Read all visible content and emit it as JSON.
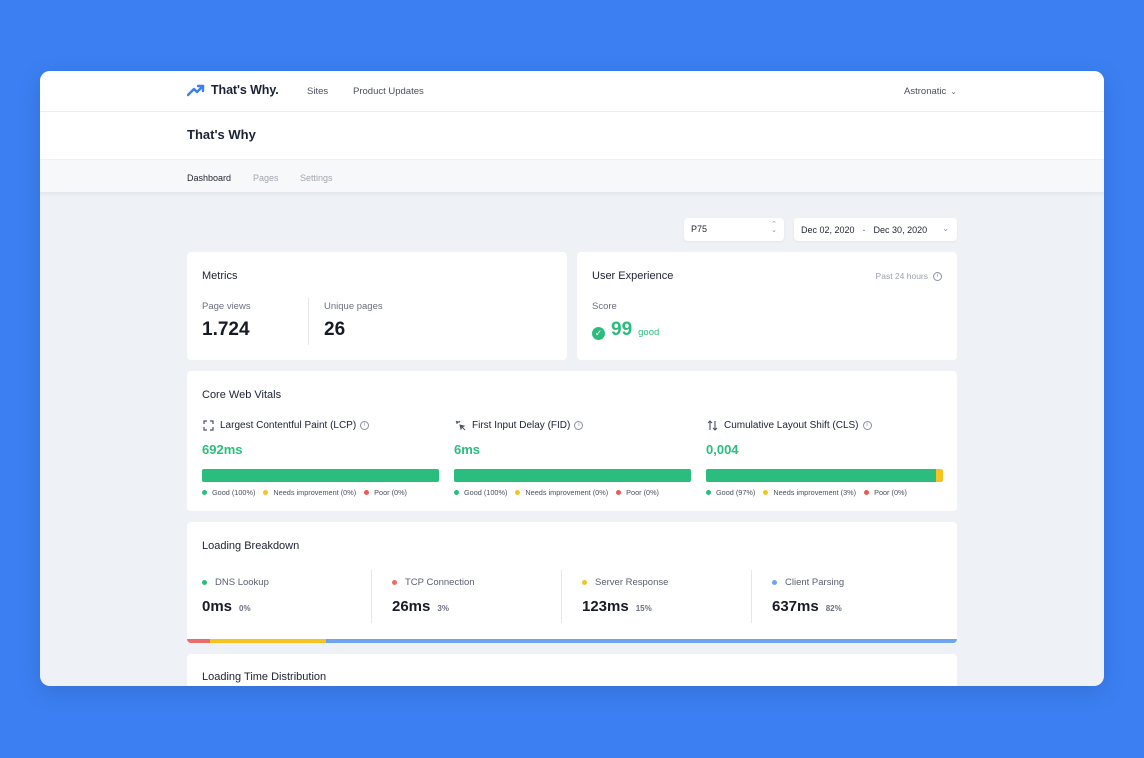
{
  "app": {
    "brand": "That's Why.",
    "nav": [
      "Sites",
      "Product Updates"
    ],
    "account": "Astronatic"
  },
  "page": {
    "title": "That's Why",
    "tabs": [
      "Dashboard",
      "Pages",
      "Settings"
    ],
    "active_tab": "Dashboard"
  },
  "filters": {
    "percentile": "P75",
    "date_from": "Dec 02, 2020",
    "date_sep": "-",
    "date_to": "Dec 30, 2020"
  },
  "metrics": {
    "title": "Metrics",
    "page_views_label": "Page views",
    "page_views": "1.724",
    "unique_pages_label": "Unique pages",
    "unique_pages": "26"
  },
  "user_experience": {
    "title": "User Experience",
    "period": "Past 24 hours",
    "score_label": "Score",
    "score": "99",
    "rating": "good"
  },
  "core_web_vitals": {
    "title": "Core Web Vitals",
    "items": [
      {
        "name": "Largest Contentful Paint (LCP)",
        "icon": "expand-icon",
        "value": "692ms",
        "good": 100,
        "ni": 0,
        "poor": 0,
        "legend": [
          "Good (100%)",
          "Needs improvement (0%)",
          "Poor (0%)"
        ]
      },
      {
        "name": "First Input Delay (FID)",
        "icon": "click-icon",
        "value": "6ms",
        "good": 100,
        "ni": 0,
        "poor": 0,
        "legend": [
          "Good (100%)",
          "Needs improvement (0%)",
          "Poor (0%)"
        ]
      },
      {
        "name": "Cumulative Layout Shift (CLS)",
        "icon": "shift-arrows-icon",
        "value": "0,004",
        "good": 97,
        "ni": 3,
        "poor": 0,
        "legend": [
          "Good (97%)",
          "Needs improvement (3%)",
          "Poor (0%)"
        ]
      }
    ]
  },
  "loading_breakdown": {
    "title": "Loading Breakdown",
    "items": [
      {
        "name": "DNS Lookup",
        "value": "0ms",
        "pct": "0%",
        "share": 0,
        "color": "#2bbd7e"
      },
      {
        "name": "TCP Connection",
        "value": "26ms",
        "pct": "3%",
        "share": 3,
        "color": "#ee6b6b"
      },
      {
        "name": "Server Response",
        "value": "123ms",
        "pct": "15%",
        "share": 15,
        "color": "#f5c322"
      },
      {
        "name": "Client Parsing",
        "value": "637ms",
        "pct": "82%",
        "share": 82,
        "color": "#6ea3f2"
      }
    ]
  },
  "loading_time_distribution": {
    "title": "Loading Time Distribution"
  },
  "colors": {
    "accent": "#3b7ff2",
    "good": "#2bbd7e",
    "needs_improvement": "#f5c322",
    "poor": "#ee5a52"
  }
}
